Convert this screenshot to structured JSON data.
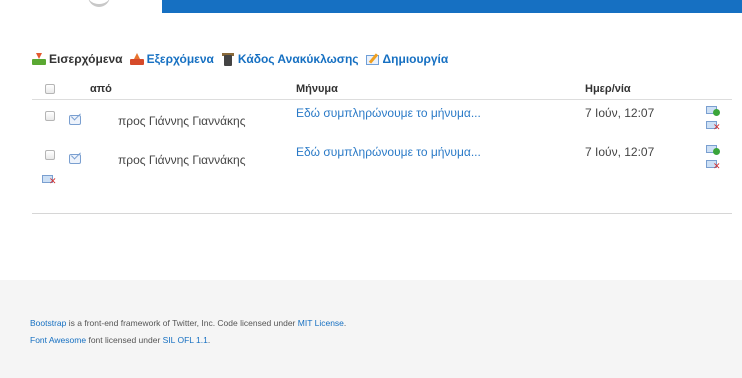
{
  "tabs": {
    "inbox": "Εισερχόμενα",
    "outbox": "Εξερχόμενα",
    "trash": "Κάδος Ανακύκλωσης",
    "create": "Δημιουργία"
  },
  "table": {
    "headers": {
      "from": "από",
      "message": "Μήνυμα",
      "date": "Ημερ/νία"
    },
    "rows": [
      {
        "from": "προς Γιάννης Γιαννάκης",
        "message": "Εδώ συμπληρώνουμε το μήνυμα...",
        "date": "7 Ιούν, 12:07"
      },
      {
        "from": "προς Γιάννης Γιαννάκης",
        "message": "Εδώ συμπληρώνουμε το μήνυμα...",
        "date": "7 Ιούν, 12:07"
      }
    ]
  },
  "footer": {
    "line1_link": "Bootstrap",
    "line1_text": "is a front-end framework of Twitter, Inc. Code licensed under",
    "line1_link2": "MIT License",
    "line2_link": "Font Awesome",
    "line2_text": "font licensed under",
    "line2_link2": "SIL OFL 1.1"
  },
  "colors": {
    "brand_blue": "#1670c2",
    "link_blue": "#2a7ac7",
    "footer_bg": "#f5f5f5"
  },
  "icons": [
    "inbox-icon",
    "outbox-icon",
    "trash-icon",
    "create-icon",
    "envelope-icon",
    "reply-icon",
    "delete-icon"
  ]
}
